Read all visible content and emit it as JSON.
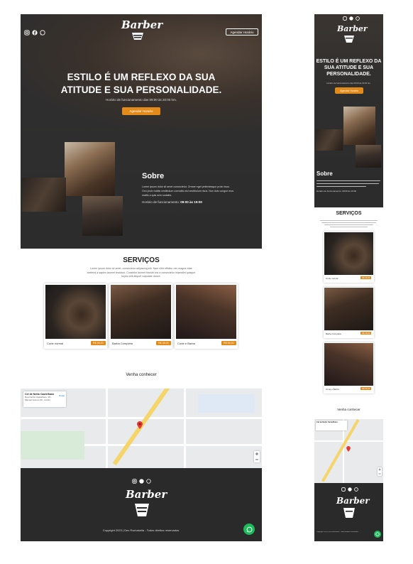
{
  "colors": {
    "accent": "#e28a1a",
    "dark": "#2e2e2e",
    "footer": "#2a2a2a",
    "whatsapp": "#1dba5a"
  },
  "desktop": {
    "brand": "Barber",
    "schedule_button": "Agendar Horário",
    "hero_title_line1": "ESTILO É UM REFLEXO DA SUA",
    "hero_title_line2": "ATITUDE E SUA PERSONALIDADE.",
    "hero_hours": "Horário de funcionamento das 09:00 às 20:00 hrs.",
    "hero_cta": "Agendar Horario",
    "about_title": "Sobre",
    "about_text_1": "Lorem ipsum dolor sit amet consectetur. Ornare eget pellentesque proin risus.",
    "about_text_2": "Orci proin mattis vestibulum convallis nisi vestibulum risus. Non duis congue eros",
    "about_text_3": "mattis a quis sem sodales.",
    "about_hours_label": "Horário de funcionamento:",
    "about_hours_value": "09:00 às 19:00",
    "services_title": "SERVIÇOS",
    "services_text_1": "Lorem ipsum dolor sit amet, consectetur adipiscing elit. Nam nibh efficitur nec magna vitae",
    "services_text_2": "eleifend a sapien laoreet tincidunt. Curabitur laoreet blandit orci a consectetur imperdiet quisque",
    "services_text_3": "turpis velit aliquet vulputate dolore.",
    "services": [
      {
        "name": "Corte normal",
        "price": "R$ 45,00"
      },
      {
        "name": "Barba Completa",
        "price": "R$ 35,00"
      },
      {
        "name": "Corte e Barba",
        "price": "R$ 65,00"
      }
    ],
    "map_title": "Venha conhecer",
    "map_place_title": "Cel de Netto Castelhano",
    "map_place_addr": "Rua Carlos Castelhano, 99 - Manoel Gomes 99 - Centro",
    "map_directions": "Rotas",
    "copyright": "Copyright 2023 | Dev Rochaseila - Todos direitos reservados."
  },
  "mobile": {
    "brand": "Barber",
    "hero_title_line1": "ESTILO É UM REFLEXO DA",
    "hero_title_line2": "SUA ATITUDE E SUA",
    "hero_title_line3": "PERSONALIDADE.",
    "hero_hours": "Horário de funcionamento das 09:00 às 20:00 hrs.",
    "hero_cta": "Agendar Horario",
    "about_title": "Sobre",
    "about_hours": "Horário de funcionamento: 09:00 às 19:00",
    "services_title": "SERVIÇOS",
    "services": [
      {
        "name": "Corte normal",
        "price": "R$ 45,00"
      },
      {
        "name": "Barba Completa",
        "price": "R$ 35,00"
      },
      {
        "name": "Corte e Barba",
        "price": "R$ 65,00"
      }
    ],
    "map_title": "Venha conhecer",
    "map_place_title": "Cel de Netto Castelhano",
    "copyright": "Copyright 2023 | Dev Rochaseila - Todos direitos reservados."
  },
  "icons": [
    "instagram-icon",
    "facebook-icon",
    "whatsapp-icon",
    "map-pin-icon",
    "zoom-in-icon",
    "zoom-out-icon"
  ]
}
